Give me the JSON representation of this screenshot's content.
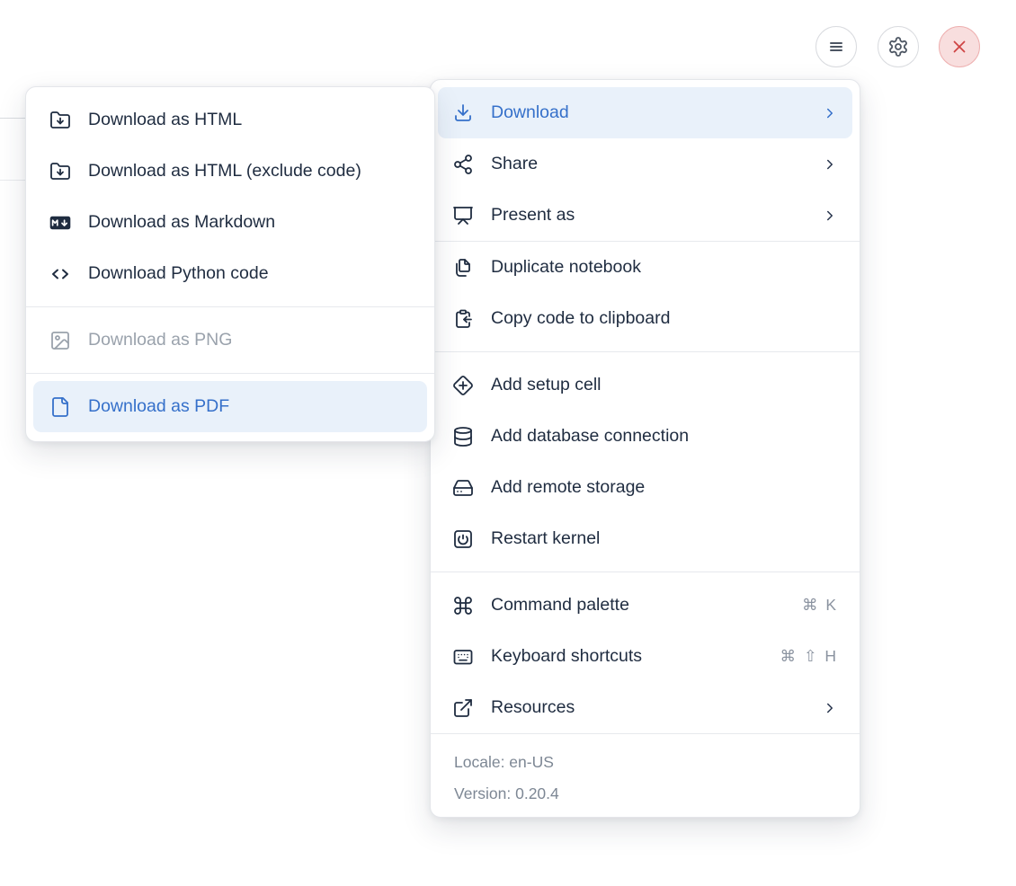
{
  "toolbar": {
    "buttons": [
      {
        "name": "notebook-menu-button",
        "icon": "hamburger-icon"
      },
      {
        "name": "settings-button",
        "icon": "gear-icon"
      },
      {
        "name": "shutdown-button",
        "icon": "close-icon"
      }
    ]
  },
  "download_submenu": {
    "items": [
      {
        "label": "Download as HTML",
        "icon": "folder-down-icon"
      },
      {
        "label": "Download as HTML (exclude code)",
        "icon": "folder-down-icon"
      },
      {
        "label": "Download as Markdown",
        "icon": "markdown-icon"
      },
      {
        "label": "Download Python code",
        "icon": "code-icon"
      },
      {
        "divider": true
      },
      {
        "label": "Download as PNG",
        "icon": "image-icon",
        "disabled": true
      },
      {
        "divider": true
      },
      {
        "label": "Download as PDF",
        "icon": "file-icon",
        "highlighted": true
      }
    ]
  },
  "main_menu": {
    "sections": [
      {
        "items": [
          {
            "label": "Download",
            "icon": "download-icon",
            "submenu": true,
            "active": true
          },
          {
            "label": "Share",
            "icon": "share-icon",
            "submenu": true
          },
          {
            "label": "Present as",
            "icon": "presentation-icon",
            "submenu": true
          }
        ]
      },
      {
        "items": [
          {
            "label": "Duplicate notebook",
            "icon": "duplicate-icon"
          },
          {
            "label": "Copy code to clipboard",
            "icon": "clipboard-copy-icon"
          }
        ]
      },
      {
        "items": [
          {
            "label": "Add setup cell",
            "icon": "diamond-plus-icon"
          },
          {
            "label": "Add database connection",
            "icon": "database-icon"
          },
          {
            "label": "Add remote storage",
            "icon": "hard-drive-icon"
          },
          {
            "label": "Restart kernel",
            "icon": "power-icon"
          }
        ]
      },
      {
        "items": [
          {
            "label": "Command palette",
            "icon": "command-icon",
            "shortcut": "⌘ K"
          },
          {
            "label": "Keyboard shortcuts",
            "icon": "keyboard-icon",
            "shortcut": "⌘ ⇧ H"
          },
          {
            "label": "Resources",
            "icon": "external-link-icon",
            "submenu": true
          }
        ]
      }
    ],
    "footer": {
      "locale": "Locale: en-US",
      "version": "Version: 0.20.4"
    }
  },
  "colors": {
    "accent_blue": "#3570ca",
    "highlight_bg": "#e9f1fa",
    "text": "#1f2c40",
    "muted": "#7d8794",
    "disabled": "#9aa2ac",
    "divider": "#e7e9ed",
    "danger_red": "#cf4444",
    "danger_bg": "#f8dede"
  }
}
